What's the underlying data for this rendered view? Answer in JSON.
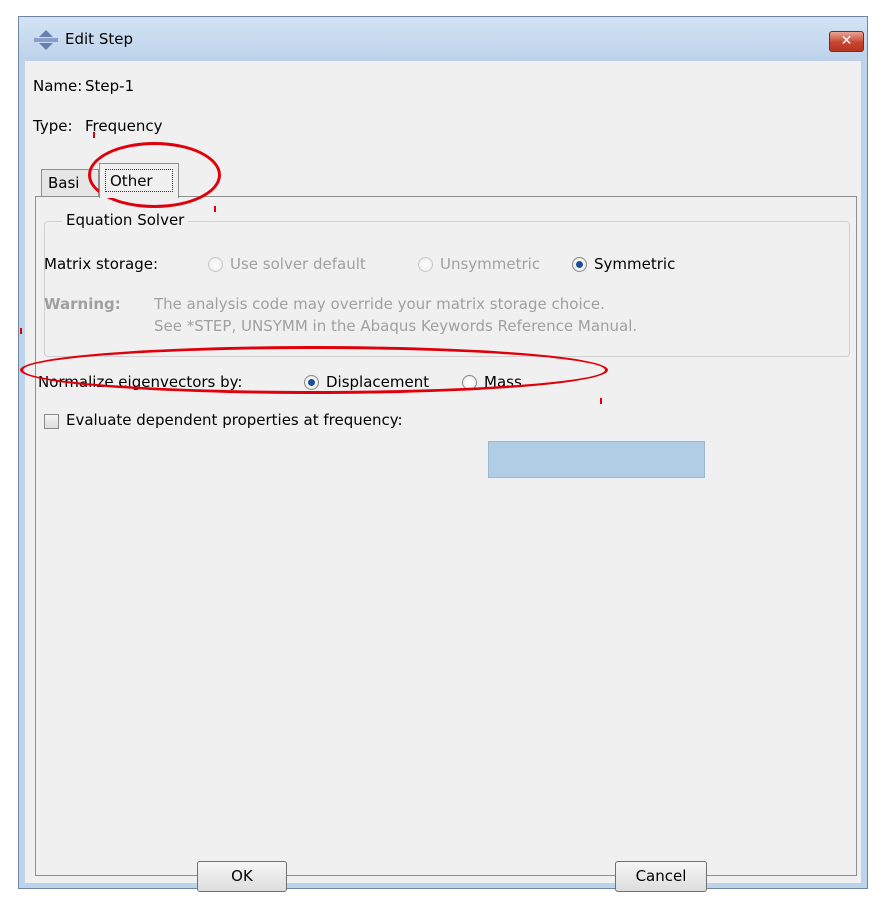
{
  "window": {
    "title": "Edit Step",
    "close_label": "✕"
  },
  "fields": {
    "name_label": "Name:",
    "name_value": "Step-1",
    "type_label": "Type:",
    "type_value": "Frequency"
  },
  "tabs": [
    {
      "label": "Basic",
      "visible_label": "Basi",
      "active": false
    },
    {
      "label": "Other",
      "active": true
    }
  ],
  "equation_solver": {
    "title": "Equation Solver",
    "matrix_storage_label": "Matrix storage:",
    "options": [
      {
        "label": "Use solver default",
        "selected": false,
        "enabled": false
      },
      {
        "label": "Unsymmetric",
        "selected": false,
        "enabled": false
      },
      {
        "label": "Symmetric",
        "selected": true,
        "enabled": true
      }
    ],
    "warning_label": "Warning:",
    "warning_line1": "The analysis code may override your matrix storage choice.",
    "warning_line2": "See *STEP, UNSYMM in the Abaqus Keywords Reference Manual."
  },
  "normalize": {
    "label": "Normalize eigenvectors by:",
    "options": [
      {
        "label": "Displacement",
        "selected": true
      },
      {
        "label": "Mass",
        "selected": false
      }
    ]
  },
  "evaluate": {
    "label": "Evaluate dependent properties at frequency:",
    "checked": false,
    "value": ""
  },
  "buttons": {
    "ok": "OK",
    "cancel": "Cancel"
  },
  "annotation_color": "#e0000b",
  "accent_color": "#1d4e9a"
}
